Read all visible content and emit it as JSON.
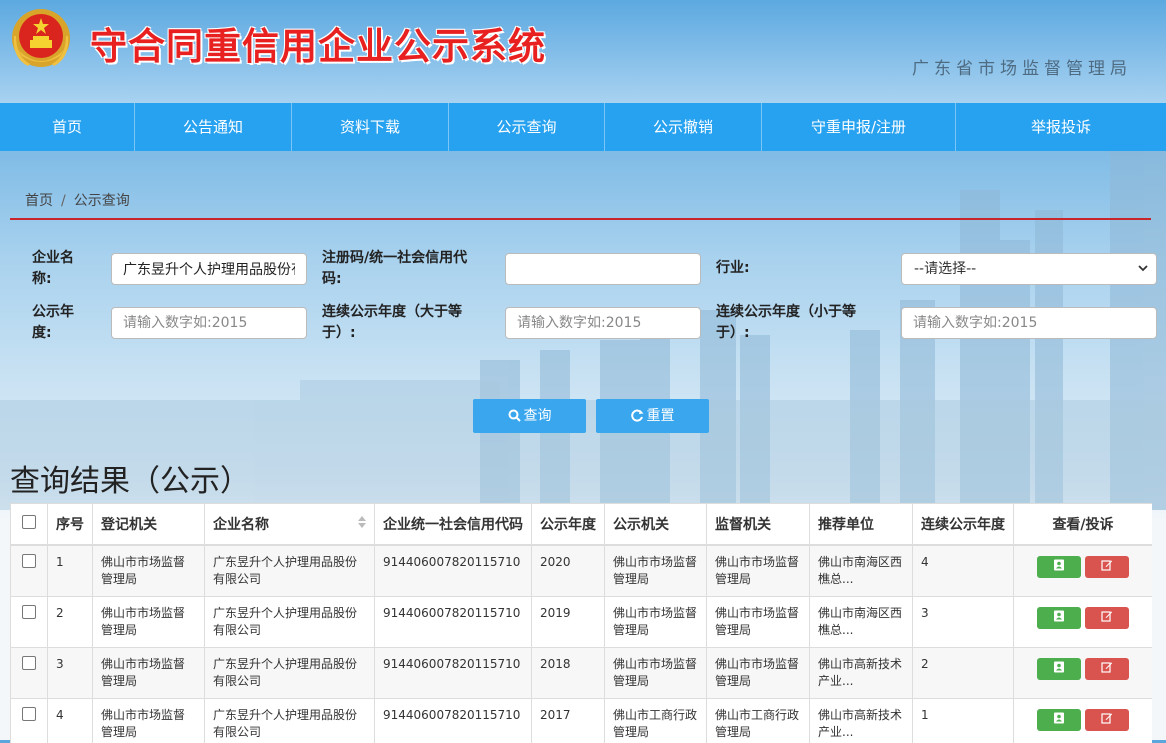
{
  "header": {
    "site_title": "守合同重信用企业公示系统",
    "agency": "广东省市场监督管理局"
  },
  "nav": {
    "items": [
      {
        "label": "首页"
      },
      {
        "label": "公告通知"
      },
      {
        "label": "资料下载"
      },
      {
        "label": "公示查询"
      },
      {
        "label": "公示撤销"
      },
      {
        "label": "守重申报/注册"
      },
      {
        "label": "举报投诉"
      }
    ]
  },
  "breadcrumb": {
    "home": "首页",
    "separator": "/",
    "current": "公示查询"
  },
  "form": {
    "company_name": {
      "label": "企业名称:",
      "value": "广东昱升个人护理用品股份有限公司"
    },
    "reg_code": {
      "label": "注册码/统一社会信用代码:",
      "value": ""
    },
    "industry": {
      "label": "行业:",
      "selected": "--请选择--"
    },
    "year": {
      "label": "公示年度:",
      "placeholder": "请输入数字如:2015"
    },
    "year_from": {
      "label": "连续公示年度（大于等于）:",
      "placeholder": "请输入数字如:2015"
    },
    "year_to": {
      "label": "连续公示年度（小于等于）:",
      "placeholder": "请输入数字如:2015"
    },
    "search_label": "查询",
    "reset_label": "重置"
  },
  "results": {
    "title": "查询结果（公示）",
    "columns": [
      "序号",
      "登记机关",
      "企业名称",
      "企业统一社会信用代码",
      "公示年度",
      "公示机关",
      "监督机关",
      "推荐单位",
      "连续公示年度",
      "查看/投诉"
    ],
    "rows": [
      {
        "no": "1",
        "reg_org": "佛山市市场监督管理局",
        "name": "广东昱升个人护理用品股份有限公司",
        "code": "914406007820115710",
        "year": "2020",
        "pub_org": "佛山市市场监督管理局",
        "sup_org": "佛山市市场监督管理局",
        "recommender": "佛山市南海区西樵总...",
        "years": "4"
      },
      {
        "no": "2",
        "reg_org": "佛山市市场监督管理局",
        "name": "广东昱升个人护理用品股份有限公司",
        "code": "914406007820115710",
        "year": "2019",
        "pub_org": "佛山市市场监督管理局",
        "sup_org": "佛山市市场监督管理局",
        "recommender": "佛山市南海区西樵总...",
        "years": "3"
      },
      {
        "no": "3",
        "reg_org": "佛山市市场监督管理局",
        "name": "广东昱升个人护理用品股份有限公司",
        "code": "914406007820115710",
        "year": "2018",
        "pub_org": "佛山市市场监督管理局",
        "sup_org": "佛山市市场监督管理局",
        "recommender": "佛山市高新技术产业...",
        "years": "2"
      },
      {
        "no": "4",
        "reg_org": "佛山市市场监督管理局",
        "name": "广东昱升个人护理用品股份有限公司",
        "code": "914406007820115710",
        "year": "2017",
        "pub_org": "佛山市工商行政管理局",
        "sup_org": "佛山市工商行政管理局",
        "recommender": "佛山市高新技术产业...",
        "years": "1"
      }
    ]
  },
  "colors": {
    "nav_bg": "#27a2f0",
    "title_red": "#e8201f",
    "divider_red": "#c9262b",
    "button_blue": "#3aa6ee",
    "view_green": "#4cae4c",
    "report_red": "#d9534f"
  },
  "icons": {
    "emblem": "national-emblem-icon",
    "search": "search-icon",
    "reset": "refresh-icon",
    "view": "contact-card-icon",
    "report": "edit-icon",
    "sort": "sort-icon"
  }
}
